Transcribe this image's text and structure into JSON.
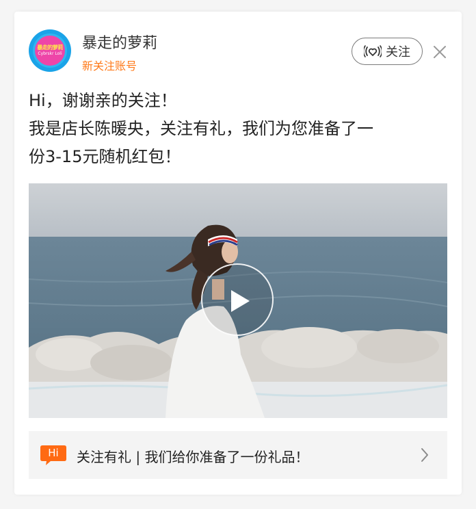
{
  "account": {
    "name": "暴走的萝莉",
    "subtitle": "新关注账号",
    "avatar_logo_text": "暴走的萝莉",
    "avatar_logo_sub": "Cybrskr Loli"
  },
  "follow_button": {
    "label": "关注",
    "icon": "heart-signal-icon"
  },
  "close": {
    "icon": "close-icon"
  },
  "message": {
    "lines": [
      "Hi，谢谢亲的关注！",
      "我是店长陈暖央，关注有礼，我们为您准备了一",
      "份3-15元随机红包！"
    ]
  },
  "video": {
    "play_icon": "play-icon"
  },
  "banner": {
    "badge": "Hi",
    "text": "关注有礼 | 我们给你准备了一份礼品！",
    "chevron_icon": "chevron-right-icon"
  },
  "colors": {
    "accent_orange": "#ff7a1a",
    "text_dark": "#222222",
    "border_gray": "#7a7a7a"
  }
}
